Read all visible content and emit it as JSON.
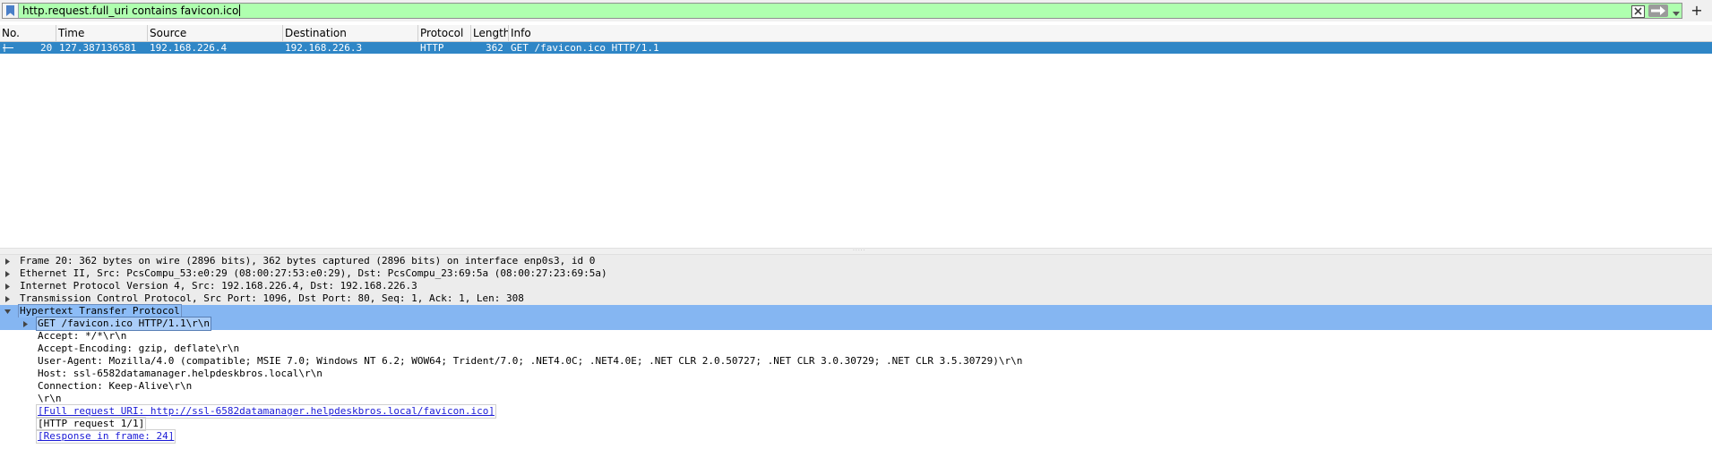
{
  "filter": {
    "expression": "http.request.full_uri contains favicon.ico",
    "valid_color": "#afffaf",
    "bookmark_icon": "bookmark-icon",
    "clear_icon": "clear-icon",
    "apply_icon": "arrow-right-icon",
    "dropdown_icon": "chevron-down-icon",
    "add_label": "+"
  },
  "packet_list": {
    "columns": [
      "No.",
      "Time",
      "Source",
      "Destination",
      "Protocol",
      "Length",
      "Info"
    ],
    "selected_row_color": "#2f86c6",
    "rows": [
      {
        "no": "20",
        "time": "127.387136581",
        "source": "192.168.226.4",
        "destination": "192.168.226.3",
        "protocol": "HTTP",
        "length": "362",
        "info": "GET /favicon.ico HTTP/1.1"
      }
    ]
  },
  "details": {
    "frame": "Frame 20: 362 bytes on wire (2896 bits), 362 bytes captured (2896 bits) on interface enp0s3, id 0",
    "ethernet": "Ethernet II, Src: PcsCompu_53:e0:29 (08:00:27:53:e0:29), Dst: PcsCompu_23:69:5a (08:00:27:23:69:5a)",
    "ip": "Internet Protocol Version 4, Src: 192.168.226.4, Dst: 192.168.226.3",
    "tcp": "Transmission Control Protocol, Src Port: 1096, Dst Port: 80, Seq: 1, Ack: 1, Len: 308",
    "http": "Hypertext Transfer Protocol",
    "http_children": {
      "request_line": "GET /favicon.ico HTTP/1.1\\r\\n",
      "accept": "Accept: */*\\r\\n",
      "accept_encoding": "Accept-Encoding: gzip, deflate\\r\\n",
      "user_agent": "User-Agent: Mozilla/4.0 (compatible; MSIE 7.0; Windows NT 6.2; WOW64; Trident/7.0; .NET4.0C; .NET4.0E; .NET CLR 2.0.50727; .NET CLR 3.0.30729; .NET CLR 3.5.30729)\\r\\n",
      "host": "Host: ssl-6582datamanager.helpdeskbros.local\\r\\n",
      "connection": "Connection: Keep-Alive\\r\\n",
      "crlf": "\\r\\n",
      "full_uri": "[Full request URI: http://ssl-6582datamanager.helpdeskbros.local/favicon.ico]",
      "request_num": "[HTTP request 1/1]",
      "response_in": "[Response in frame: 24]"
    },
    "highlight_color": "#85b6f2"
  }
}
